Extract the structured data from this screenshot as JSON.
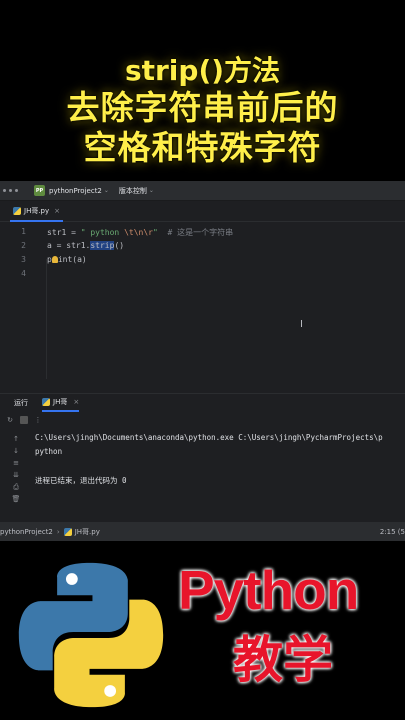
{
  "overlay": {
    "line1": "strip()方法",
    "line2": "去除字符串前后的",
    "line3": "空格和特殊字符",
    "brand": "Python",
    "subtitle": "教学"
  },
  "topbar": {
    "badge": "PP",
    "project": "pythonProject2",
    "vcs": "版本控制"
  },
  "editor": {
    "tab_label": "JH哥.py",
    "line_numbers": [
      "1",
      "2",
      "3",
      "4"
    ],
    "lines": [
      {
        "p1": "str1 = ",
        "s1": "\" python ",
        "e1": "\\t\\n\\r",
        "s2": "\"",
        "c1": "  # 这是一个字符串"
      },
      {
        "p1": "a = str1.",
        "sel": "strip",
        "p2": "()"
      },
      {
        "p1": "p",
        "p2": "int(a)"
      },
      {
        "p1": ""
      }
    ]
  },
  "run": {
    "label": "运行",
    "tab_label": "JH哥",
    "console": [
      "C:\\Users\\jingh\\Documents\\anaconda\\python.exe C:\\Users\\jingh\\PycharmProjects\\p",
      "python",
      "",
      "进程已结束，退出代码为 0"
    ]
  },
  "status": {
    "project": "pythonProject2",
    "file": "JH哥.py",
    "position": "2:15 (5"
  },
  "colors": {
    "title_yellow": "#ffef4a",
    "brand_red": "#e8152b",
    "ide_bg": "#1e1f22",
    "accent_blue": "#3574f0"
  }
}
